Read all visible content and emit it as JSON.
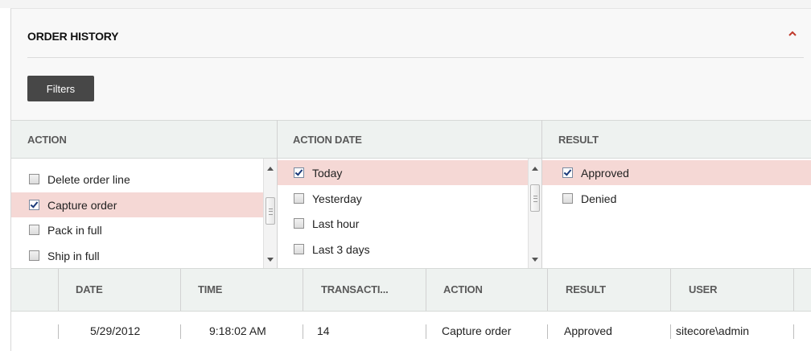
{
  "panel": {
    "title": "ORDER HISTORY",
    "collapse_icon": "chevron-up-icon",
    "accent_color": "#c0392b",
    "filters_button": "Filters"
  },
  "filters": {
    "action": {
      "label": "ACTION",
      "options": [
        {
          "label": "Delete order line",
          "checked": false
        },
        {
          "label": "Capture order",
          "checked": true
        },
        {
          "label": "Pack in full",
          "checked": false
        },
        {
          "label": "Ship in full",
          "checked": false
        }
      ]
    },
    "action_date": {
      "label": "ACTION DATE",
      "options": [
        {
          "label": "Today",
          "checked": true
        },
        {
          "label": "Yesterday",
          "checked": false
        },
        {
          "label": "Last hour",
          "checked": false
        },
        {
          "label": "Last 3 days",
          "checked": false
        }
      ]
    },
    "result": {
      "label": "RESULT",
      "options": [
        {
          "label": "Approved",
          "checked": true
        },
        {
          "label": "Denied",
          "checked": false
        }
      ]
    },
    "selected_row_color": "#f5d8d5"
  },
  "grid": {
    "columns": [
      "DATE",
      "TIME",
      "TRANSACTI...",
      "ACTION",
      "RESULT",
      "USER"
    ],
    "rows": [
      [
        "5/29/2012",
        "9:18:02 AM",
        "14",
        "Capture order",
        "Approved",
        "sitecore\\admin"
      ]
    ]
  }
}
